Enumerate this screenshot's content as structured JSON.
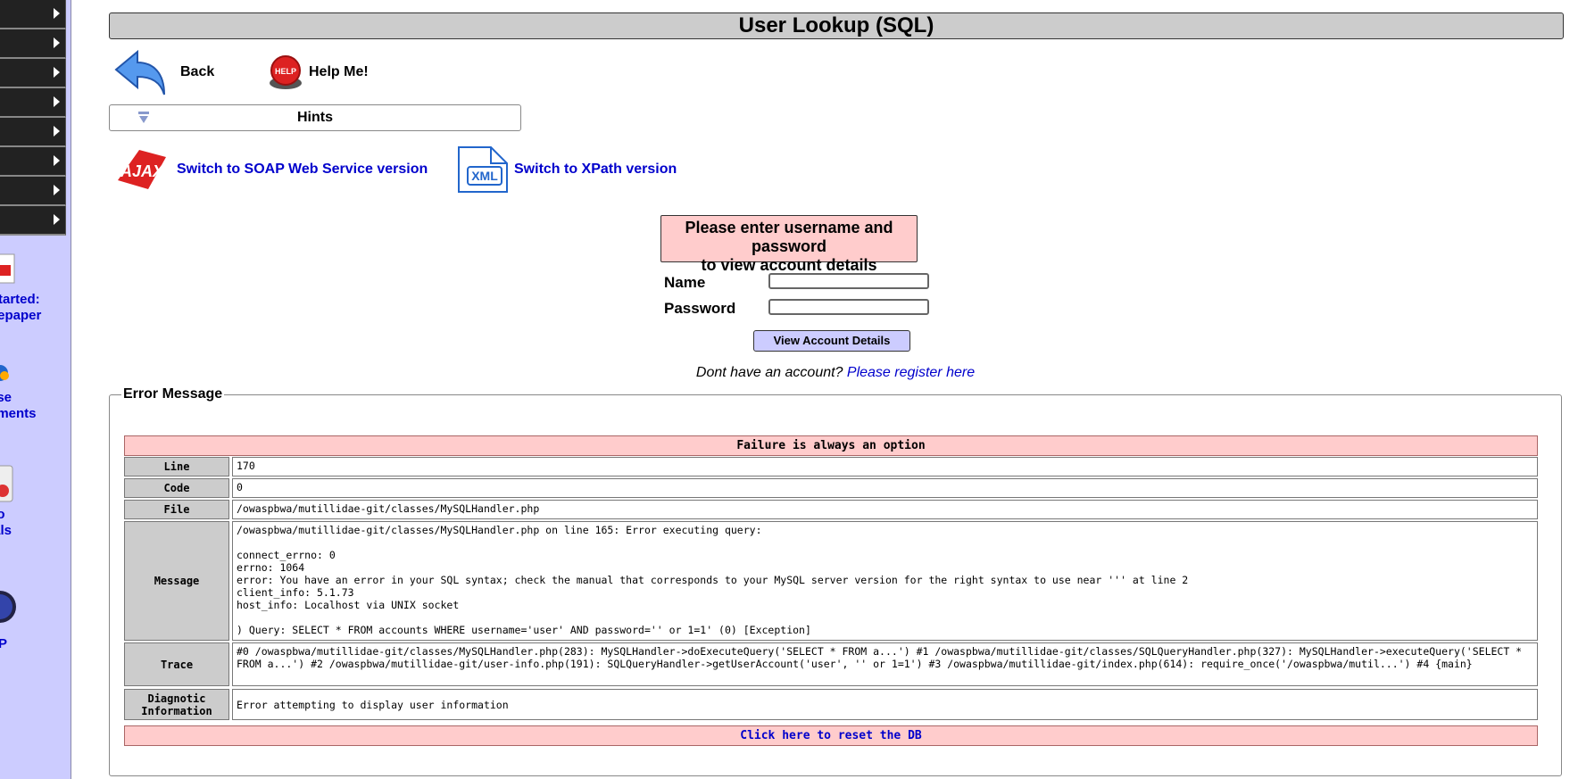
{
  "sidebar": {
    "menu_item_count": 8,
    "links": [
      {
        "line1": "Started:",
        "line2": "itepaper",
        "icon": "pdf-icon"
      },
      {
        "line1": "ase",
        "line2": "ements",
        "icon": "release-icon"
      },
      {
        "line1": "eo",
        "line2": "ials",
        "icon": "video-icon"
      },
      {
        "line1": "SP",
        "line2": "",
        "icon": "globe-icon"
      }
    ]
  },
  "header": {
    "title": "User Lookup (SQL)"
  },
  "nav": {
    "back_label": "Back",
    "help_label": "Help Me!",
    "hints_label": "Hints"
  },
  "switch_links": {
    "soap": "Switch to SOAP Web Service version",
    "xpath": "Switch to XPath version"
  },
  "login": {
    "heading_line1": "Please enter username and password",
    "heading_line2": "to view account details",
    "name_label": "Name",
    "name_value": "",
    "password_label": "Password",
    "password_value": "",
    "submit_label": "View Account Details",
    "register_prefix": "Dont have an account?",
    "register_link": "Please register here"
  },
  "error": {
    "legend": "Error Message",
    "header": "Failure is always an option",
    "rows": [
      {
        "key": "Line",
        "value": "170"
      },
      {
        "key": "Code",
        "value": "0"
      },
      {
        "key": "File",
        "value": "/owaspbwa/mutillidae-git/classes/MySQLHandler.php"
      },
      {
        "key": "Message",
        "value": "/owaspbwa/mutillidae-git/classes/MySQLHandler.php on line 165: Error executing query:\n\nconnect_errno: 0\nerrno: 1064\nerror: You have an error in your SQL syntax; check the manual that corresponds to your MySQL server version for the right syntax to use near ''' at line 2\nclient_info: 5.1.73\nhost_info: Localhost via UNIX socket\n\n) Query: SELECT * FROM accounts WHERE username='user' AND password='' or 1=1' (0) [Exception]"
      },
      {
        "key": "Trace",
        "value": "#0 /owaspbwa/mutillidae-git/classes/MySQLHandler.php(283): MySQLHandler->doExecuteQuery('SELECT * FROM a...') #1 /owaspbwa/mutillidae-git/classes/SQLQueryHandler.php(327): MySQLHandler->executeQuery('SELECT * FROM a...') #2 /owaspbwa/mutillidae-git/user-info.php(191): SQLQueryHandler->getUserAccount('user', '' or 1=1') #3 /owaspbwa/mutillidae-git/index.php(614): require_once('/owaspbwa/mutil...') #4 {main}"
      },
      {
        "key": "Diagnotic Information",
        "value": "Error attempting to display user information"
      }
    ],
    "reset_label": "Click here to reset the DB"
  }
}
